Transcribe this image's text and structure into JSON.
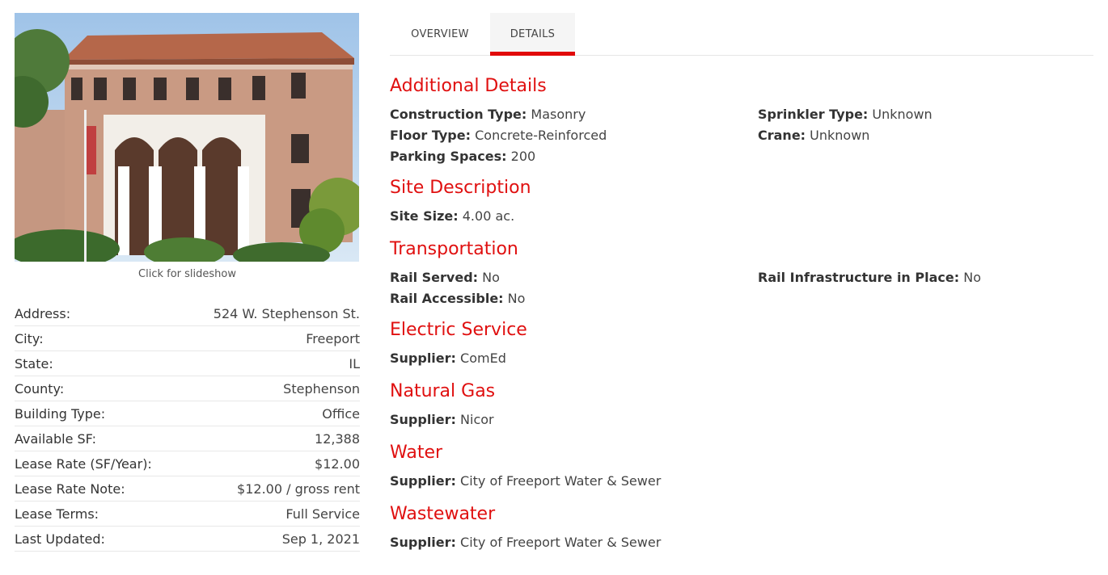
{
  "photo": {
    "caption": "Click for slideshow"
  },
  "facts": [
    {
      "label": "Address:",
      "value": "524 W. Stephenson St."
    },
    {
      "label": "City:",
      "value": "Freeport"
    },
    {
      "label": "State:",
      "value": "IL"
    },
    {
      "label": "County:",
      "value": "Stephenson"
    },
    {
      "label": "Building Type:",
      "value": "Office"
    },
    {
      "label": "Available SF:",
      "value": "12,388"
    },
    {
      "label": "Lease Rate (SF/Year):",
      "value": "$12.00"
    },
    {
      "label": "Lease Rate Note:",
      "value": "$12.00 / gross rent"
    },
    {
      "label": "Lease Terms:",
      "value": "Full Service"
    },
    {
      "label": "Last Updated:",
      "value": "Sep 1, 2021"
    }
  ],
  "tabs": [
    {
      "label": "OVERVIEW",
      "active": false
    },
    {
      "label": "DETAILS",
      "active": true
    }
  ],
  "sections": {
    "additional": {
      "title": "Additional Details",
      "construction_label": "Construction Type:",
      "construction_value": "Masonry",
      "sprinkler_label": "Sprinkler Type:",
      "sprinkler_value": "Unknown",
      "floor_label": "Floor Type:",
      "floor_value": "Concrete-Reinforced",
      "crane_label": "Crane:",
      "crane_value": "Unknown",
      "parking_label": "Parking Spaces:",
      "parking_value": "200"
    },
    "site": {
      "title": "Site Description",
      "size_label": "Site Size:",
      "size_value": "4.00 ac."
    },
    "transportation": {
      "title": "Transportation",
      "rail_served_label": "Rail Served:",
      "rail_served_value": "No",
      "rail_infra_label": "Rail Infrastructure in Place:",
      "rail_infra_value": "No",
      "rail_accessible_label": "Rail Accessible:",
      "rail_accessible_value": "No"
    },
    "electric": {
      "title": "Electric Service",
      "supplier_label": "Supplier:",
      "supplier_value": "ComEd"
    },
    "gas": {
      "title": "Natural Gas",
      "supplier_label": "Supplier:",
      "supplier_value": "Nicor"
    },
    "water": {
      "title": "Water",
      "supplier_label": "Supplier:",
      "supplier_value": "City of Freeport Water & Sewer"
    },
    "wastewater": {
      "title": "Wastewater",
      "supplier_label": "Supplier:",
      "supplier_value": "City of Freeport Water & Sewer"
    }
  },
  "colors": {
    "accent": "#e01010",
    "tab_underline": "#e10a0a"
  }
}
